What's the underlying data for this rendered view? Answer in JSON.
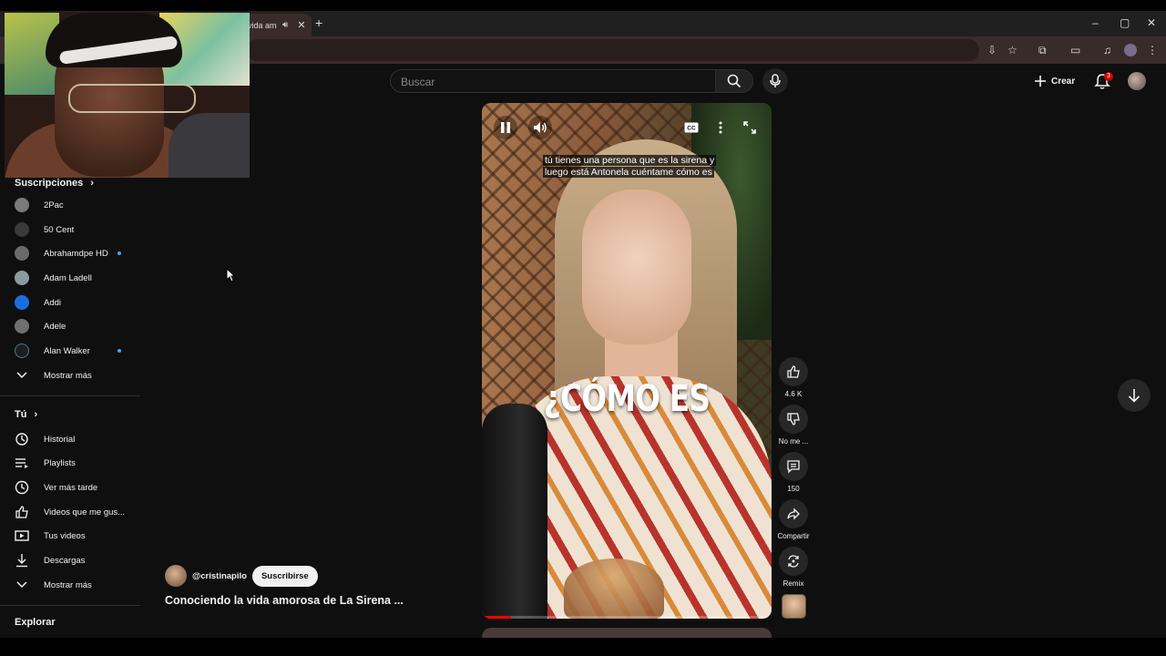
{
  "browser": {
    "tab_title": "vida amo",
    "new_tab_symbol": "+",
    "window_controls": [
      "–",
      "▢",
      "✕"
    ]
  },
  "header": {
    "search_placeholder": "Buscar",
    "create_label": "Crear",
    "notification_count": "3"
  },
  "sidebar": {
    "subscriptions_heading": "Suscripciones",
    "subscriptions": [
      {
        "name": "2Pac",
        "avatar_color": "#7a7a7a",
        "new": false
      },
      {
        "name": "50 Cent",
        "avatar_color": "#3a3a3a",
        "new": false
      },
      {
        "name": "Abrahamdpe HD",
        "avatar_color": "#6a6a6a",
        "new": true
      },
      {
        "name": "Adam Ladell",
        "avatar_color": "#8a9aa0",
        "new": false
      },
      {
        "name": "Addi",
        "avatar_color": "#1a6fe0",
        "new": false
      },
      {
        "name": "Adele",
        "avatar_color": "#707070",
        "new": false
      },
      {
        "name": "Alan Walker",
        "avatar_color": "#1e1e1e",
        "new": true
      }
    ],
    "show_more_1": "Mostrar más",
    "you_heading": "Tú",
    "you_items": [
      {
        "label": "Historial",
        "icon": "history-icon"
      },
      {
        "label": "Playlists",
        "icon": "playlist-icon"
      },
      {
        "label": "Ver más tarde",
        "icon": "clock-icon"
      },
      {
        "label": "Videos que me gus...",
        "icon": "thumbs-up-icon"
      },
      {
        "label": "Tus videos",
        "icon": "play-box-icon"
      },
      {
        "label": "Descargas",
        "icon": "download-icon"
      }
    ],
    "show_more_2": "Mostrar más",
    "explore_heading": "Explorar"
  },
  "video": {
    "caption_line1": "tú tienes una persona que es la sirena y",
    "caption_line2": "luego está Antonela cuéntame cómo es",
    "overlay_text": "¿CÓMO ES",
    "progress": 0.1,
    "channel_handle": "@cristinapilo",
    "subscribe_label": "Suscribirse",
    "title": "Conociendo la vida amorosa de La Sirena ..."
  },
  "actions": {
    "like_count": "4.6 K",
    "dislike_label": "No me ...",
    "comments_count": "150",
    "share_label": "Compartir",
    "remix_label": "Remix"
  },
  "colors": {
    "accent_red": "#ff0000",
    "new_dot": "#3ea6ff",
    "background": "#0f0f0f"
  }
}
